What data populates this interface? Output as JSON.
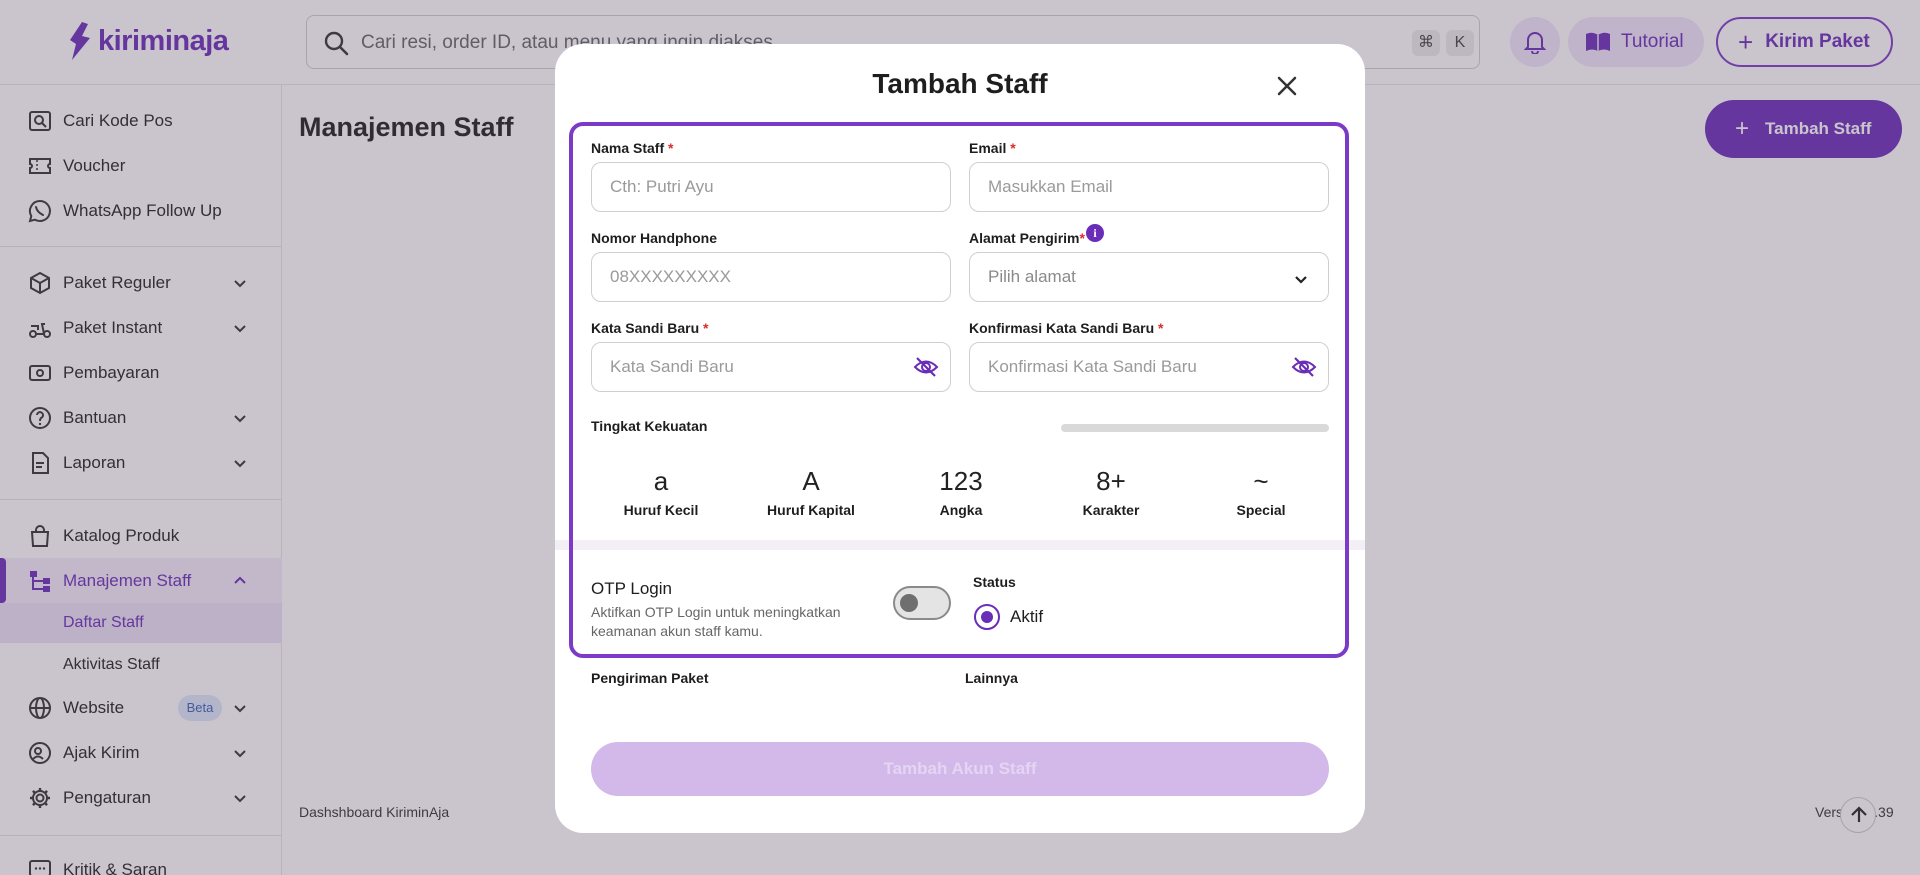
{
  "app": {
    "logo_text": "kiriminaja",
    "brand_color": "#6a2db8"
  },
  "topbar": {
    "search_placeholder": "Cari resi, order ID, atau menu yang ingin diakses",
    "shortcut_cmd": "⌘",
    "shortcut_key": "K",
    "tutorial_label": "Tutorial",
    "kirim_label": "Kirim Paket"
  },
  "sidebar": {
    "items": [
      {
        "label": "Cari Kode Pos",
        "icon": "search-map-icon"
      },
      {
        "label": "Voucher",
        "icon": "voucher-icon"
      },
      {
        "label": "WhatsApp Follow Up",
        "icon": "whatsapp-icon"
      },
      {
        "label": "Paket Reguler",
        "icon": "box-icon"
      },
      {
        "label": "Paket Instant",
        "icon": "scooter-icon"
      },
      {
        "label": "Pembayaran",
        "icon": "money-icon"
      },
      {
        "label": "Bantuan",
        "icon": "help-icon"
      },
      {
        "label": "Laporan",
        "icon": "report-icon"
      },
      {
        "label": "Katalog Produk",
        "icon": "bag-icon"
      },
      {
        "label": "Manajemen Staff",
        "icon": "org-chart-icon"
      },
      {
        "label": "Website",
        "icon": "globe-icon",
        "badge": "Beta"
      },
      {
        "label": "Ajak Kirim",
        "icon": "referral-icon"
      },
      {
        "label": "Pengaturan",
        "icon": "gear-icon"
      },
      {
        "label": "Kritik & Saran",
        "icon": "feedback-icon"
      }
    ],
    "sub_items": [
      "Daftar Staff",
      "Aktivitas Staff"
    ]
  },
  "main": {
    "title": "Manajemen Staff",
    "add_button": "Tambah Staff",
    "footer_left": "Dashshboard KiriminAja",
    "footer_right": "Vers      2.39"
  },
  "modal": {
    "title": "Tambah Staff",
    "fields": {
      "name": {
        "label": "Nama Staff",
        "placeholder": "Cth: Putri Ayu",
        "value": ""
      },
      "email": {
        "label": "Email",
        "placeholder": "Masukkan Email",
        "value": ""
      },
      "phone": {
        "label": "Nomor Handphone",
        "placeholder": "08XXXXXXXXX",
        "value": ""
      },
      "address": {
        "label": "Alamat Pengirim",
        "placeholder": "Pilih alamat"
      },
      "password": {
        "label": "Kata Sandi Baru",
        "placeholder": "Kata Sandi Baru",
        "value": ""
      },
      "confirm": {
        "label": "Konfirmasi Kata Sandi Baru",
        "placeholder": "Konfirmasi Kata Sandi Baru",
        "value": ""
      }
    },
    "required_mark": "*",
    "info_mark": "i",
    "strength": {
      "label": "Tingkat Kekuatan",
      "level": 0,
      "criteria": [
        {
          "symbol": "a",
          "label": "Huruf Kecil"
        },
        {
          "symbol": "A",
          "label": "Huruf Kapital"
        },
        {
          "symbol": "123",
          "label": "Angka"
        },
        {
          "symbol": "8+",
          "label": "Karakter"
        },
        {
          "symbol": "~",
          "label": "Special"
        }
      ]
    },
    "otp": {
      "title": "OTP Login",
      "description": "Aktifkan OTP Login untuk meningkatkan keamanan akun staff kamu.",
      "enabled": false
    },
    "status": {
      "label": "Status",
      "option": "Aktif",
      "selected": true
    },
    "sections": [
      "Pengiriman Paket",
      "Lainnya"
    ],
    "submit_label": "Tambah Akun Staff"
  }
}
